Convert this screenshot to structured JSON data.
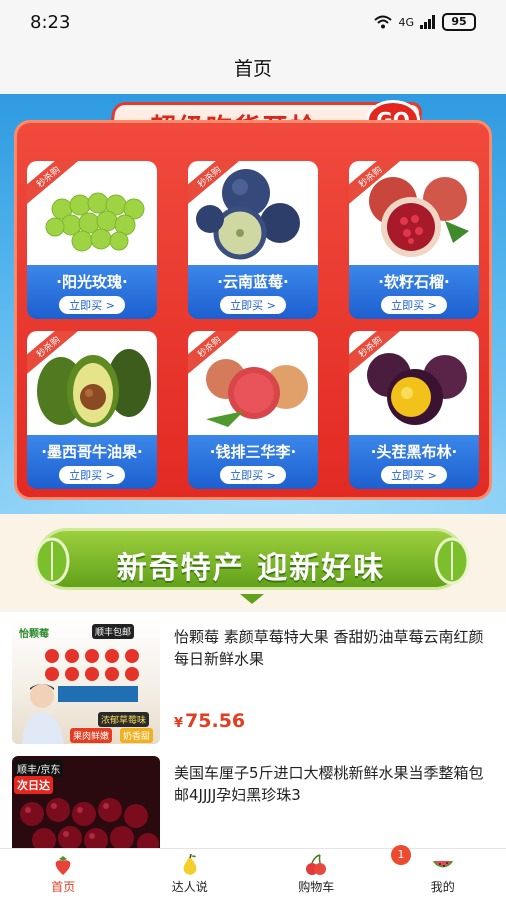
{
  "status_bar": {
    "time": "8:23",
    "network": "4G",
    "battery": "95"
  },
  "header": {
    "title": "首页"
  },
  "promo": {
    "title": "超级吃货开抢",
    "go_label": "GO",
    "tag": "秒杀购",
    "buy_label": "立即买 >",
    "products": [
      {
        "name": "·阳光玫瑰·",
        "icon": "grape-icon"
      },
      {
        "name": "·云南蓝莓·",
        "icon": "blueberry-icon"
      },
      {
        "name": "·软籽石榴·",
        "icon": "pomegranate-icon"
      },
      {
        "name": "·墨西哥牛油果·",
        "icon": "avocado-icon"
      },
      {
        "name": "·钱排三华李·",
        "icon": "plum-icon"
      },
      {
        "name": "·头茬黑布林·",
        "icon": "black-plum-icon"
      }
    ]
  },
  "section": {
    "title": "新奇特产 迎新好味"
  },
  "products": [
    {
      "title": "怡颗莓 素颜草莓特大果 香甜奶油草莓云南红颜每日新鲜水果",
      "currency": "¥",
      "price": "75.56",
      "thumb": {
        "brand": "怡颗莓",
        "ship": "顺丰包邮",
        "tag1": "浓郁草莓味",
        "tag2": "果肉鲜嫩",
        "tag3": "奶香甜"
      }
    },
    {
      "title": "美国车厘子5斤进口大樱桃新鲜水果当季整箱包邮4JJJJ孕妇黑珍珠3",
      "thumb": {
        "ship": "顺丰/京东",
        "tag1": "次日达"
      }
    }
  ],
  "bottom_nav": [
    {
      "label": "首页",
      "active": true,
      "icon": "strawberry-icon"
    },
    {
      "label": "达人说",
      "active": false,
      "icon": "pear-icon"
    },
    {
      "label": "购物车",
      "active": false,
      "icon": "cherry-icon",
      "badge": "1"
    },
    {
      "label": "我的",
      "active": false,
      "icon": "watermelon-icon"
    }
  ],
  "colors": {
    "accent": "#e33d22",
    "promo_blue": "#2e9ae0",
    "promo_red": "#e22a23",
    "section_green": "#62a11c"
  }
}
